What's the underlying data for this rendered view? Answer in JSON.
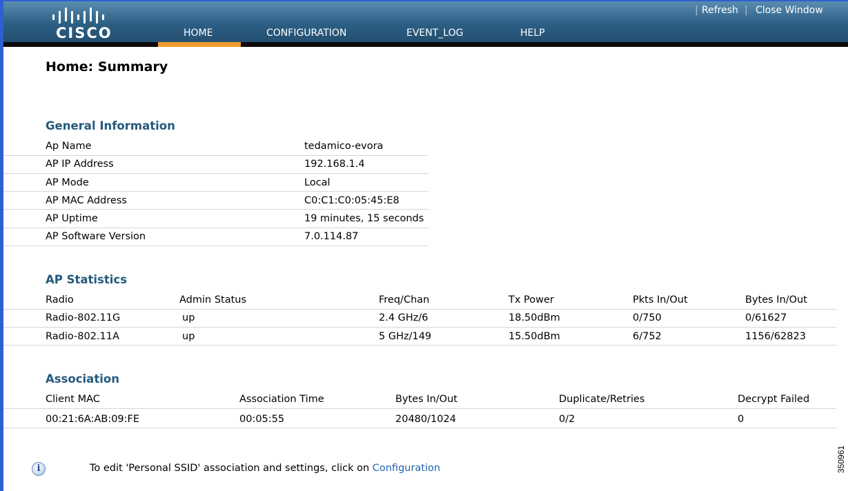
{
  "header": {
    "logo_text": "CISCO",
    "nav": [
      {
        "label": "HOME",
        "active": true
      },
      {
        "label": "CONFIGURATION",
        "active": false
      },
      {
        "label": "EVENT_LOG",
        "active": false
      },
      {
        "label": "HELP",
        "active": false
      }
    ],
    "refresh_label": "Refresh",
    "close_window_label": "Close Window",
    "separator": "|"
  },
  "page_title": "Home: Summary",
  "general": {
    "title": "General Information",
    "rows": [
      {
        "label": "Ap Name",
        "value": "tedamico-evora"
      },
      {
        "label": "AP IP Address",
        "value": "192.168.1.4"
      },
      {
        "label": "AP Mode",
        "value": "Local"
      },
      {
        "label": "AP MAC Address",
        "value": "C0:C1:C0:05:45:E8"
      },
      {
        "label": "AP Uptime",
        "value": "19 minutes, 15 seconds"
      },
      {
        "label": "AP Software Version",
        "value": "7.0.114.87"
      }
    ]
  },
  "stats": {
    "title": "AP Statistics",
    "headers": [
      "Radio",
      "Admin Status",
      "Freq/Chan",
      "Tx Power",
      "Pkts In/Out",
      "Bytes In/Out"
    ],
    "rows": [
      [
        "Radio-802.11G",
        "up",
        "2.4 GHz/6",
        "18.50dBm",
        "0/750",
        "0/61627"
      ],
      [
        "Radio-802.11A",
        "up",
        "5 GHz/149",
        "15.50dBm",
        "6/752",
        "1156/62823"
      ]
    ]
  },
  "association": {
    "title": "Association",
    "headers": [
      "Client MAC",
      "Association Time",
      "Bytes In/Out",
      "Duplicate/Retries",
      "Decrypt Failed"
    ],
    "rows": [
      [
        "00:21:6A:AB:09:FE",
        "00:05:55",
        "20480/1024",
        "0/2",
        "0"
      ]
    ]
  },
  "note": {
    "text": "To edit 'Personal SSID' association and settings, click on",
    "link": "Configuration"
  },
  "figure_id": "350961",
  "colors": {
    "accent": "#f39c2a",
    "section_title": "#245a7c",
    "link": "#1f63b0"
  }
}
